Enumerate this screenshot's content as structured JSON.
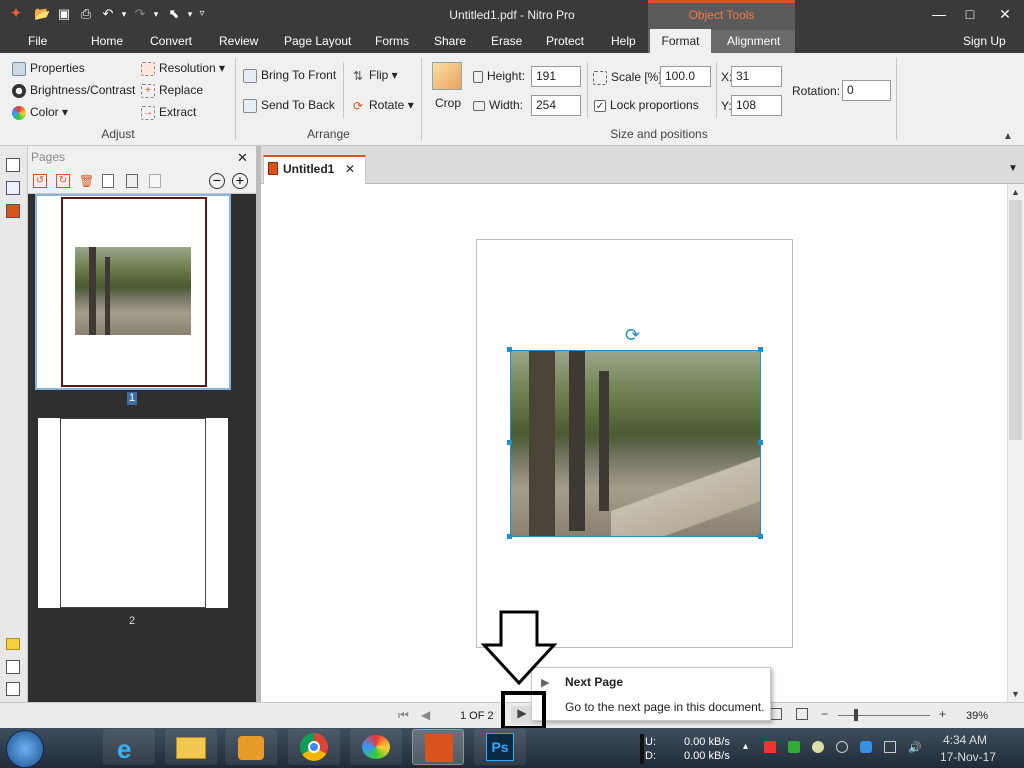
{
  "window": {
    "title": "Untitled1.pdf - Nitro Pro",
    "context_tab": "Object Tools"
  },
  "menu": {
    "file": "File",
    "home": "Home",
    "convert": "Convert",
    "review": "Review",
    "page_layout": "Page Layout",
    "forms": "Forms",
    "share": "Share",
    "erase": "Erase",
    "protect": "Protect",
    "help": "Help",
    "format": "Format",
    "alignment": "Alignment",
    "sign_up": "Sign Up"
  },
  "ribbon": {
    "adjust": {
      "properties": "Properties",
      "brightness": "Brightness/Contrast",
      "color": "Color",
      "resolution": "Resolution",
      "replace": "Replace",
      "extract": "Extract",
      "group": "Adjust"
    },
    "arrange": {
      "bring_front": "Bring To Front",
      "send_back": "Send To Back",
      "flip": "Flip",
      "rotate": "Rotate",
      "group": "Arrange"
    },
    "size": {
      "crop": "Crop",
      "height_label": "Height:",
      "height": "191",
      "width_label": "Width:",
      "width": "254",
      "scale_label": "Scale [%]:",
      "scale": "100.0",
      "lock_label": "Lock proportions",
      "x_label": "X:",
      "x": "31",
      "y_label": "Y:",
      "y": "108",
      "rotation_label": "Rotation:",
      "rotation": "0",
      "group": "Size and positions"
    }
  },
  "pages_panel": {
    "title": "Pages",
    "thumb1_label": "1",
    "thumb2_label": "2"
  },
  "doc": {
    "tab_label": "Untitled1"
  },
  "tooltip": {
    "title": "Next Page",
    "body": "Go to the next page in this document."
  },
  "status": {
    "page_indicator": "1 OF 2",
    "zoom": "39%"
  },
  "taskbar": {
    "net_u_label": "U:",
    "net_d_label": "D:",
    "up_rate": "0.00 kB/s",
    "down_rate": "0.00 kB/s",
    "time": "4:34 AM",
    "date": "17-Nov-17"
  },
  "colors": {
    "accent": "#d9531e",
    "selection": "#1e90d0",
    "titlebar": "#3a3a3a"
  }
}
